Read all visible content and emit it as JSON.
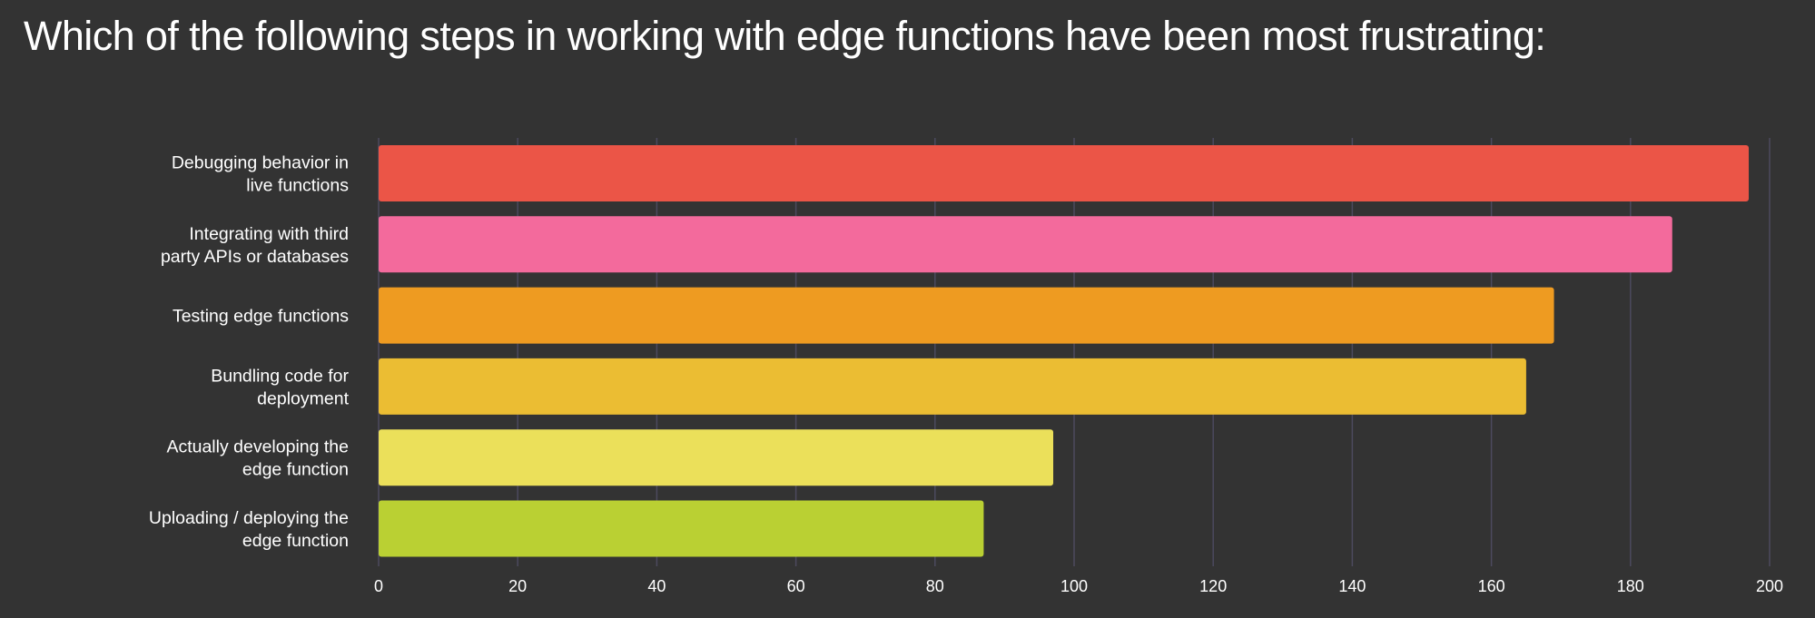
{
  "chart_data": {
    "type": "bar",
    "orientation": "horizontal",
    "title": "Which of the following steps in working with edge functions have been most frustrating:",
    "xlabel": "",
    "ylabel": "",
    "categories": [
      [
        "Debugging behavior in",
        "live functions"
      ],
      [
        "Integrating with third",
        "party APIs or databases"
      ],
      [
        "Testing edge functions"
      ],
      [
        "Bundling code for",
        "deployment"
      ],
      [
        "Actually developing the",
        "edge function"
      ],
      [
        "Uploading / deploying the",
        "edge function"
      ]
    ],
    "values": [
      197,
      186,
      169,
      165,
      97,
      87
    ],
    "colors": [
      "#EB5547",
      "#F36A9C",
      "#EE9B21",
      "#EBBD33",
      "#EBE05A",
      "#BAD033"
    ],
    "xlim": [
      0,
      200
    ],
    "xticks": [
      0,
      20,
      40,
      60,
      80,
      100,
      120,
      140,
      160,
      180,
      200
    ],
    "grid": true,
    "legend": "none"
  },
  "theme": {
    "background": "#333333",
    "grid_color": "#4C4A5E",
    "text_color": "#FFFFFF"
  }
}
